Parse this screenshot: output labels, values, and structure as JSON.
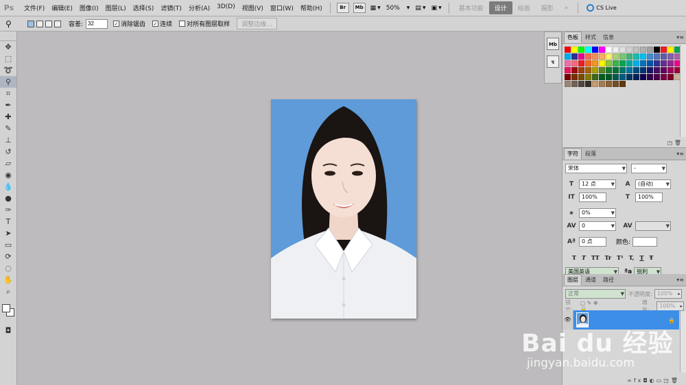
{
  "app": {
    "logo": "Ps"
  },
  "menu": [
    "文件(F)",
    "编辑(E)",
    "图像(I)",
    "图层(L)",
    "选择(S)",
    "滤镜(T)",
    "分析(A)",
    "3D(D)",
    "视图(V)",
    "窗口(W)",
    "帮助(H)"
  ],
  "appbar": {
    "btn_br": "Br",
    "btn_mb": "Mb",
    "zoom": "50%"
  },
  "workspaces": {
    "basic": "基本功能",
    "design": "设计",
    "painting": "绘画",
    "photography": "摄影",
    "more": "»",
    "cslive": "CS Live"
  },
  "options": {
    "tolerance_label": "容差:",
    "tolerance_value": "32",
    "antialias": "消除锯齿",
    "contiguous": "连续",
    "sample_all": "对所有图层取样",
    "refine": "调整边缘..."
  },
  "panels": {
    "swatches_tabs": [
      "色板",
      "样式",
      "信息"
    ],
    "character_tabs": [
      "字符",
      "段落"
    ],
    "layers_tabs": [
      "图层",
      "通道",
      "路径"
    ]
  },
  "character": {
    "font_family": "宋体",
    "font_style": "-",
    "size": "12 点",
    "leading": "(自动)",
    "vscale": "100%",
    "hscale": "100%",
    "baseline_pct": "0%",
    "tracking": "0",
    "baseline_shift": "0 点",
    "color_label": "颜色:",
    "typo": [
      "T",
      "T",
      "TT",
      "Tr",
      "T¹",
      "T,",
      "T",
      "Ŧ"
    ],
    "language": "美国英语",
    "aa_label": "ªa",
    "antialias": "锐利"
  },
  "layers": {
    "blend": "正常",
    "opacity_label": "不透明度:",
    "opacity": "100%",
    "lock_label": "锁定:",
    "fill_label": "填充:",
    "fill": "100%"
  },
  "watermark": {
    "line1": "Bai du 经验",
    "line2": "jingyan.baidu.com"
  },
  "swatch_colors": [
    "#ff0000",
    "#ffff00",
    "#00ff00",
    "#00ffff",
    "#0000ff",
    "#ff00ff",
    "#ffffff",
    "#f0f0f0",
    "#e0e0e0",
    "#d0d0d0",
    "#c0c0c0",
    "#b0b0b0",
    "#a0a0a0",
    "#000000",
    "#ee1d24",
    "#fff200",
    "#00a651",
    "#00aeef",
    "#2e3192",
    "#ec008c",
    "#f26c4f",
    "#f68e55",
    "#fbaf5c",
    "#fff467",
    "#acd372",
    "#7cc576",
    "#3bb878",
    "#1abbb4",
    "#00bff3",
    "#438ccb",
    "#5574b9",
    "#605ca8",
    "#855fa8",
    "#a763a8",
    "#f06ea9",
    "#f26d7d",
    "#ed1c24",
    "#f26522",
    "#f7941d",
    "#fff200",
    "#8dc63f",
    "#39b54a",
    "#00a651",
    "#00a99d",
    "#00aeef",
    "#0072bc",
    "#0054a6",
    "#2e3192",
    "#662d91",
    "#92278f",
    "#ec008c",
    "#ed145b",
    "#9e0b0f",
    "#a0410d",
    "#a36209",
    "#aba000",
    "#598527",
    "#1a7b30",
    "#007236",
    "#00746b",
    "#0076a3",
    "#004b80",
    "#003471",
    "#1b1464",
    "#440e62",
    "#630460",
    "#9e005d",
    "#9e0039",
    "#790000",
    "#7b2e00",
    "#7d4900",
    "#827b00",
    "#406618",
    "#005e20",
    "#005826",
    "#005952",
    "#005b7f",
    "#003663",
    "#002157",
    "#0d004c",
    "#32004b",
    "#4b0049",
    "#7b0046",
    "#7a0026",
    "#c7b299",
    "#998675",
    "#736357",
    "#534741",
    "#37302a",
    "#c69c6d",
    "#a67c52",
    "#8c6239",
    "#754c24",
    "#603913"
  ]
}
